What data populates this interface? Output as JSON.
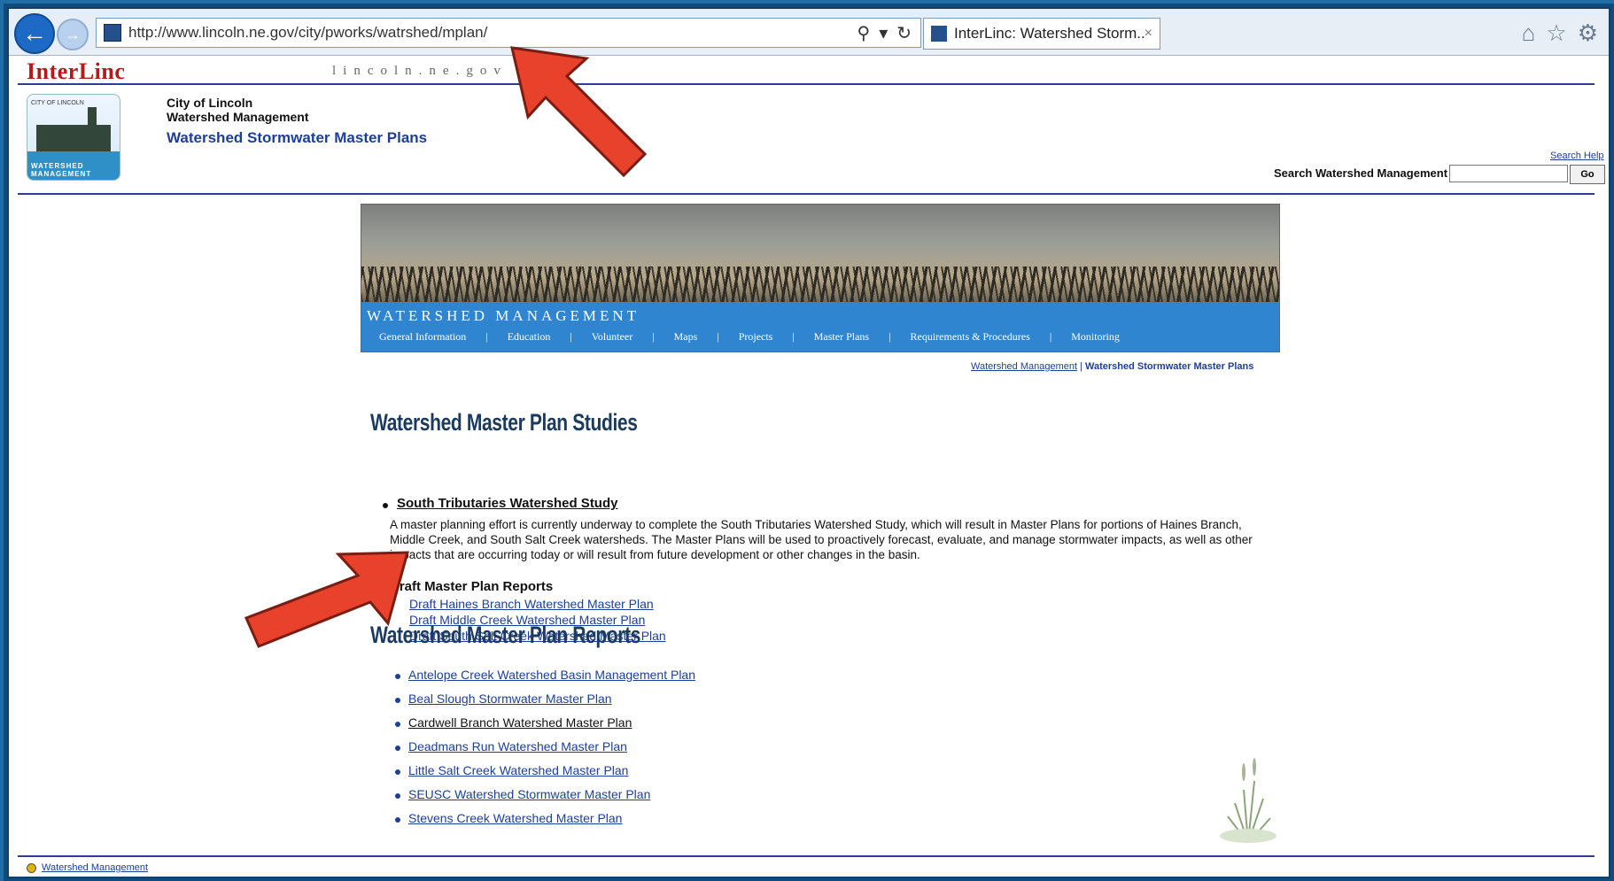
{
  "browser": {
    "url": "http://www.lincoln.ne.gov/city/pworks/watrshed/mplan/",
    "tab_title": "InterLinc: Watershed Storm...",
    "tab_close": "×"
  },
  "header": {
    "brand": "InterLinc",
    "brand_sub": "lincoln.ne.gov",
    "logo_top": "CITY OF LINCOLN",
    "logo_bottom": "WATERSHED MANAGEMENT",
    "city": "City of Lincoln",
    "dept": "Watershed Management",
    "page_title": "Watershed Stormwater Master Plans",
    "search_help": "Search Help",
    "search_label": "Search Watershed Management",
    "go_label": "Go"
  },
  "banner": {
    "title": "Watershed Management",
    "nav": [
      "General Information",
      "Education",
      "Volunteer",
      "Maps",
      "Projects",
      "Master Plans",
      "Requirements & Procedures",
      "Monitoring"
    ]
  },
  "breadcrumb": {
    "link": "Watershed Management",
    "current": "Watershed Stormwater Master Plans"
  },
  "studies": {
    "heading": "Watershed Master Plan Studies",
    "study_title": "South Tributaries Watershed Study",
    "description": "A master planning effort is currently underway to complete the South Tributaries Watershed Study, which will result in Master Plans for portions of Haines Branch, Middle Creek, and South Salt Creek watersheds. The Master Plans will be used to proactively forecast, evaluate, and manage stormwater impacts, as well as other impacts that are occurring today or will result from future development or other changes in the basin.",
    "draft_heading": "Draft Master Plan Reports",
    "drafts": [
      "Draft Haines Branch Watershed Master Plan",
      "Draft Middle Creek Watershed Master Plan",
      "Draft South Salt Creek Watershed Master Plan"
    ]
  },
  "reports": {
    "heading": "Watershed Master Plan Reports",
    "items": [
      "Antelope Creek Watershed Basin Management Plan",
      "Beal Slough Stormwater Master Plan",
      "Cardwell Branch Watershed Master Plan",
      "Deadmans Run Watershed Master Plan",
      "Little Salt Creek Watershed Master Plan",
      "SEUSC Watershed Stormwater Master Plan",
      "Stevens Creek Watershed Master Plan"
    ]
  },
  "footer": {
    "link": "Watershed Management"
  },
  "colors": {
    "link": "#1c3f9b",
    "banner_blue": "#2f85cf",
    "arrow_red": "#e8412c"
  }
}
